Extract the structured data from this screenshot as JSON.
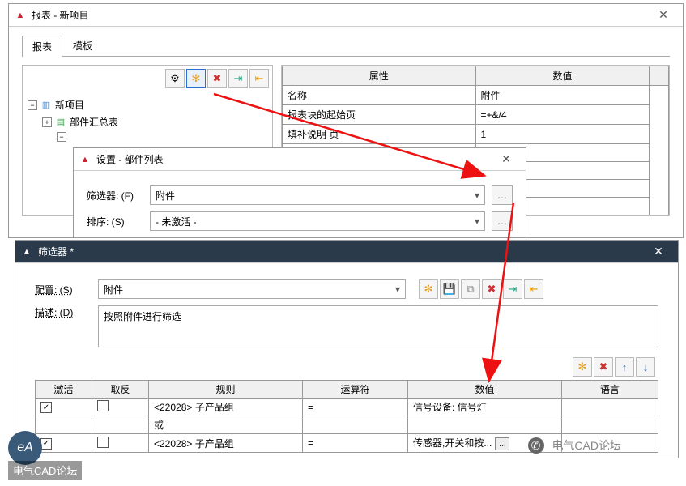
{
  "win1": {
    "title": "报表 - 新项目",
    "tabs": [
      "报表",
      "模板"
    ],
    "toolbar_icons": [
      "gear",
      "new",
      "delete",
      "import",
      "export"
    ],
    "tree": {
      "root": "新项目",
      "child1": "部件汇总表"
    },
    "grid": {
      "headers": [
        "属性",
        "数值"
      ],
      "rows": [
        [
          "名称",
          "附件"
        ],
        [
          "报表块的起始页",
          "=+&/4"
        ],
        [
          "填补说明 页",
          "1"
        ]
      ]
    }
  },
  "win2": {
    "title": "设置 - 部件列表",
    "filter_label": "筛选器: (F)",
    "filter_value": "附件",
    "sort_label": "排序: (S)",
    "sort_value": "- 未激活 -"
  },
  "win3": {
    "title": "筛选器 *",
    "config_label": "配置: (S)",
    "config_value": "附件",
    "desc_label": "描述: (D)",
    "desc_value": "按照附件进行筛选",
    "table": {
      "headers": [
        "激活",
        "取反",
        "规则",
        "运算符",
        "数值",
        "语言"
      ],
      "rows": [
        {
          "active": true,
          "negate": false,
          "rule": "<22028> 子产品组",
          "op": "=",
          "value": "信号设备: 信号灯",
          "lang": ""
        },
        {
          "active": false,
          "negate": false,
          "rule": "或",
          "op": "",
          "value": "",
          "lang": ""
        },
        {
          "active": true,
          "negate": false,
          "rule": "<22028> 子产品组",
          "op": "=",
          "value": "传感器,开关和按...",
          "lang": ""
        }
      ]
    }
  },
  "watermark": "电气CAD论坛",
  "logo_text": "电气CAD论坛",
  "logo_badge": "eA"
}
